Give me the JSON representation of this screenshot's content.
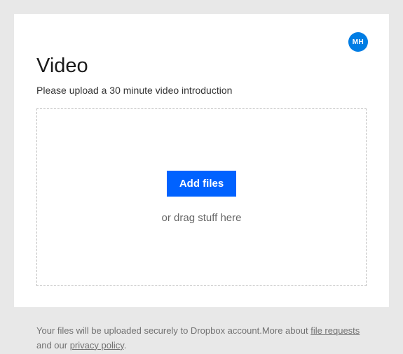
{
  "avatar": {
    "initials": "MH"
  },
  "header": {
    "title": "Video",
    "subtitle": "Please upload a 30 minute video introduction"
  },
  "dropzone": {
    "button_label": "Add files",
    "hint": "or drag stuff here"
  },
  "footer": {
    "text_before": "Your files will be uploaded securely to Dropbox account.More about ",
    "link1": "file requests",
    "text_mid": " and our ",
    "link2": "privacy policy",
    "text_after": "."
  }
}
